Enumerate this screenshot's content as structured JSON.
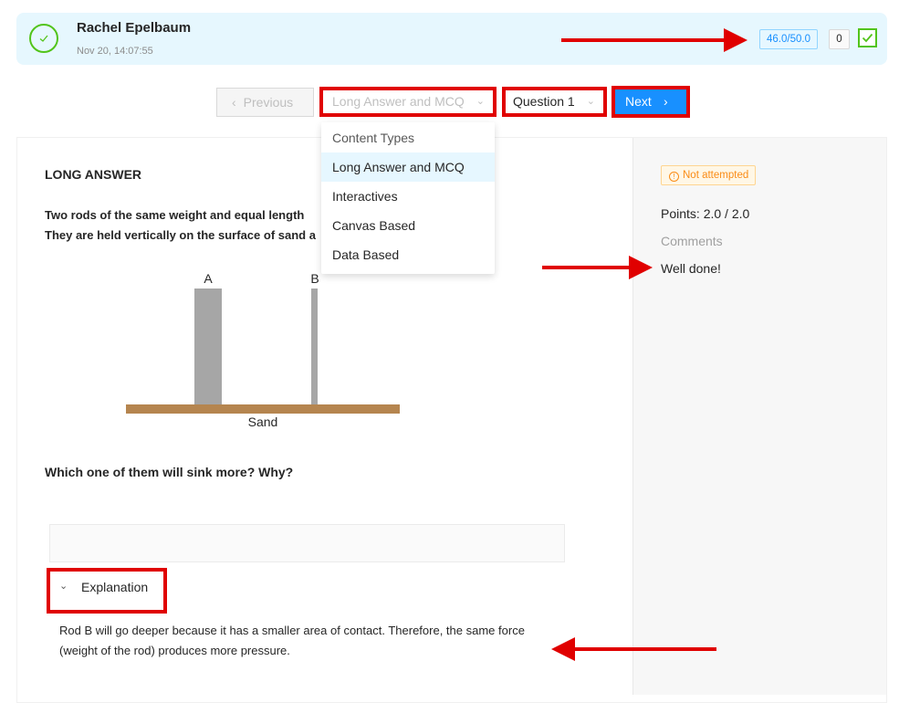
{
  "header": {
    "student_name": "Rachel Epelbaum",
    "timestamp": "Nov 20, 14:07:55",
    "score": "46.0/50.0",
    "count": "0"
  },
  "nav": {
    "previous_label": "Previous",
    "content_type_value": "Long Answer and MCQ",
    "question_value": "Question 1",
    "next_label": "Next"
  },
  "dropdown": {
    "options": [
      "Content Types",
      "Long Answer and MCQ",
      "Interactives",
      "Canvas Based",
      "Data Based"
    ],
    "selected": "Long Answer and MCQ"
  },
  "question": {
    "heading": "LONG ANSWER",
    "line1": "Two rods of the same weight and equal length",
    "line2": "They are held vertically on the surface of sand a",
    "diagram_label_a": "A",
    "diagram_label_b": "B",
    "diagram_label_sand": "Sand",
    "prompt": "Which one of them will sink more? Why?"
  },
  "explanation": {
    "toggle_label": "Explanation",
    "text": "Rod B will go deeper because it has a smaller area of contact. Therefore, the same force (weight of the rod) produces more pressure."
  },
  "grading": {
    "status": "Not attempted",
    "points": "Points: 2.0 / 2.0",
    "comments_label": "Comments",
    "comment": "Well done!"
  },
  "colors": {
    "annotation_red": "#e00000",
    "primary_blue": "#1890ff",
    "success_green": "#52c41a",
    "warning_orange": "#fa8c16",
    "header_bg": "#e6f7fe",
    "sand_brown": "#b5854f",
    "rod_gray": "#a6a6a6"
  },
  "icons": [
    "check-circle-icon",
    "check-square-icon",
    "chevron-left-icon",
    "chevron-right-icon",
    "chevron-down-icon",
    "info-circle-icon"
  ]
}
